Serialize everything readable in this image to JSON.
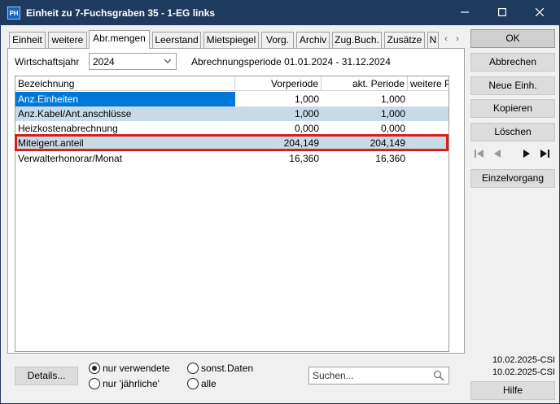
{
  "titlebar": {
    "app_icon_text": "PH",
    "title": "Einheit zu 7-Fuchsgraben 35  - 1-EG links"
  },
  "tabs": [
    {
      "label": "Einheit"
    },
    {
      "label": "weitere"
    },
    {
      "label": "Abr.mengen",
      "active": true
    },
    {
      "label": "Leerstand"
    },
    {
      "label": "Mietspiegel"
    },
    {
      "label": "Vorg."
    },
    {
      "label": "Archiv"
    },
    {
      "label": "Zug.Buch."
    },
    {
      "label": "Zusätze"
    },
    {
      "label": "N"
    }
  ],
  "filter": {
    "year_label": "Wirtschaftsjahr",
    "year_value": "2024",
    "period_text": "Abrechnungsperiode 01.01.2024 - 31.12.2024"
  },
  "grid": {
    "columns": [
      "Bezeichnung",
      "Vorperiode",
      "akt. Periode",
      "weitere P"
    ],
    "rows": [
      {
        "name": "Anz.Einheiten",
        "prev": "1,000",
        "curr": "1,000"
      },
      {
        "name": "Anz.Kabel/Ant.anschlüsse",
        "prev": "1,000",
        "curr": "1,000"
      },
      {
        "name": "Heizkostenabrechnung",
        "prev": "0,000",
        "curr": "0,000"
      },
      {
        "name": "Miteigent.anteil",
        "prev": "204,149",
        "curr": "204,149"
      },
      {
        "name": "Verwalterhonorar/Monat",
        "prev": "16,360",
        "curr": "16,360"
      }
    ]
  },
  "buttons": {
    "ok": "OK",
    "cancel": "Abbrechen",
    "new_unit": "Neue Einh.",
    "copy": "Kopieren",
    "delete": "Löschen",
    "single_process": "Einzelvorgang",
    "help": "Hilfe",
    "details": "Details..."
  },
  "version": {
    "line1": "10.02.2025-CSI",
    "line2": "10.02.2025-CSI"
  },
  "options": {
    "used_only": "nur verwendete",
    "yearly_only": "nur 'jährliche'",
    "other_data": "sonst.Daten",
    "all": "alle"
  },
  "search": {
    "placeholder": "Suchen..."
  },
  "colors": {
    "titlebar": "#1f3a5f",
    "selection": "#0078d7",
    "alt_row": "#c8dae6",
    "highlight": "#d61f1f"
  }
}
